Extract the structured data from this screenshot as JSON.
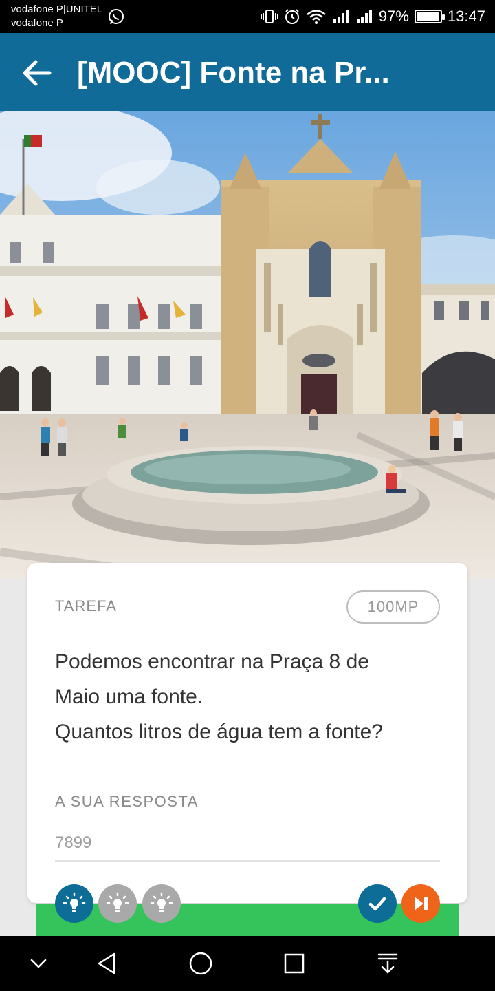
{
  "status_bar": {
    "carrier_1": "vodafone P|UNITEL",
    "carrier_2": "vodafone P",
    "battery_percent": "97%",
    "battery_level": 0.97,
    "time": "13:47",
    "icons": [
      "whatsapp-icon",
      "vibrate-icon",
      "alarm-icon",
      "wifi-icon",
      "signal-icon",
      "signal-icon",
      "battery-icon"
    ]
  },
  "app_bar": {
    "title": "[MOOC] Fonte na Pr...",
    "back_icon": "arrow-left-icon",
    "color": "#116b98"
  },
  "hero": {
    "image": "photo of a stone church facade and white building behind a round fountain in a paved square"
  },
  "card": {
    "task_label": "TAREFA",
    "points": "100MP",
    "question_lines": [
      "Podemos encontrar na Praça 8 de",
      "Maio uma fonte.",
      "Quantos litros de água tem a fonte?"
    ],
    "answer_label": "A SUA RESPOSTA",
    "answer_placeholder": "7899"
  },
  "actions": {
    "hint_icon": "lightbulb-icon",
    "check_icon": "check-icon",
    "skip_icon": "skip-next-icon",
    "colors": {
      "primary": "#0e6d97",
      "disabled": "#a9a9a9",
      "skip": "#ef6418",
      "progress": "#35c35b"
    }
  },
  "nav_bar": {
    "icons": [
      "chevron-down-icon",
      "back-triangle-icon",
      "home-circle-icon",
      "recents-square-icon",
      "notification-down-icon"
    ]
  }
}
